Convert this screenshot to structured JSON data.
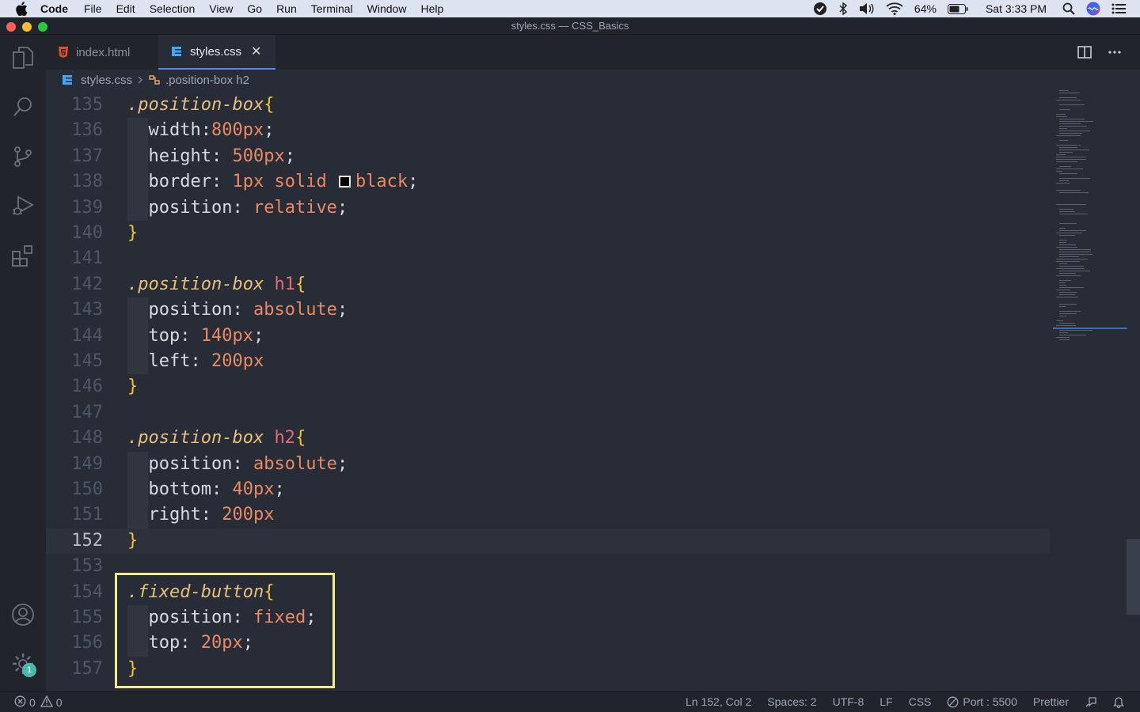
{
  "menubar": {
    "app": "Code",
    "items": [
      "File",
      "Edit",
      "Selection",
      "View",
      "Go",
      "Run",
      "Terminal",
      "Window",
      "Help"
    ],
    "battery": "64%",
    "clock": "Sat 3:33 PM"
  },
  "window": {
    "title": "styles.css — CSS_Basics"
  },
  "tabs": [
    {
      "label": "index.html",
      "icon": "html5-icon",
      "active": false
    },
    {
      "label": "styles.css",
      "icon": "css3-icon",
      "active": true
    }
  ],
  "breadcrumb": {
    "file": "styles.css",
    "symbol": ".position-box h2"
  },
  "activity_badge": "1",
  "code": {
    "current_line": 152,
    "lines": [
      {
        "n": "135",
        "tokens": [
          [
            "sel",
            ".position-box"
          ],
          [
            "brace",
            "{"
          ]
        ]
      },
      {
        "n": "136",
        "tokens": [
          [
            "prop",
            "width"
          ],
          [
            "punct",
            ":"
          ],
          [
            "val",
            "800px"
          ],
          [
            "punct",
            ";"
          ]
        ]
      },
      {
        "n": "137",
        "tokens": [
          [
            "prop",
            "height"
          ],
          [
            "punct",
            ": "
          ],
          [
            "val",
            "500px"
          ],
          [
            "punct",
            ";"
          ]
        ]
      },
      {
        "n": "138",
        "tokens": [
          [
            "prop",
            "border"
          ],
          [
            "punct",
            ": "
          ],
          [
            "val",
            "1px solid "
          ],
          [
            "swatch",
            ""
          ],
          [
            "val",
            "black"
          ],
          [
            "punct",
            ";"
          ]
        ]
      },
      {
        "n": "139",
        "tokens": [
          [
            "prop",
            "position"
          ],
          [
            "punct",
            ": "
          ],
          [
            "val",
            "relative"
          ],
          [
            "punct",
            ";"
          ]
        ]
      },
      {
        "n": "140",
        "tokens": [
          [
            "brace",
            "}"
          ]
        ]
      },
      {
        "n": "141",
        "tokens": []
      },
      {
        "n": "142",
        "tokens": [
          [
            "sel",
            ".position-box "
          ],
          [
            "tag",
            "h1"
          ],
          [
            "brace",
            "{"
          ]
        ]
      },
      {
        "n": "143",
        "tokens": [
          [
            "prop",
            "position"
          ],
          [
            "punct",
            ": "
          ],
          [
            "val",
            "absolute"
          ],
          [
            "punct",
            ";"
          ]
        ]
      },
      {
        "n": "144",
        "tokens": [
          [
            "prop",
            "top"
          ],
          [
            "punct",
            ": "
          ],
          [
            "val",
            "140px"
          ],
          [
            "punct",
            ";"
          ]
        ]
      },
      {
        "n": "145",
        "tokens": [
          [
            "prop",
            "left"
          ],
          [
            "punct",
            ": "
          ],
          [
            "val",
            "200px"
          ]
        ]
      },
      {
        "n": "146",
        "tokens": [
          [
            "brace",
            "}"
          ]
        ]
      },
      {
        "n": "147",
        "tokens": []
      },
      {
        "n": "148",
        "tokens": [
          [
            "sel",
            ".position-box "
          ],
          [
            "tag",
            "h2"
          ],
          [
            "brace",
            "{"
          ]
        ]
      },
      {
        "n": "149",
        "tokens": [
          [
            "prop",
            "position"
          ],
          [
            "punct",
            ": "
          ],
          [
            "val",
            "absolute"
          ],
          [
            "punct",
            ";"
          ]
        ]
      },
      {
        "n": "150",
        "tokens": [
          [
            "prop",
            "bottom"
          ],
          [
            "punct",
            ": "
          ],
          [
            "val",
            "40px"
          ],
          [
            "punct",
            ";"
          ]
        ]
      },
      {
        "n": "151",
        "tokens": [
          [
            "prop",
            "right"
          ],
          [
            "punct",
            ": "
          ],
          [
            "val",
            "200px"
          ]
        ]
      },
      {
        "n": "152",
        "tokens": [
          [
            "brace",
            "}"
          ]
        ]
      },
      {
        "n": "153",
        "tokens": []
      },
      {
        "n": "154",
        "tokens": [
          [
            "sel",
            ".fixed-button"
          ],
          [
            "brace",
            "{"
          ]
        ]
      },
      {
        "n": "155",
        "tokens": [
          [
            "prop",
            "position"
          ],
          [
            "punct",
            ": "
          ],
          [
            "val",
            "fixed"
          ],
          [
            "punct",
            ";"
          ]
        ]
      },
      {
        "n": "156",
        "tokens": [
          [
            "prop",
            "top"
          ],
          [
            "punct",
            ": "
          ],
          [
            "val",
            "20px"
          ],
          [
            "punct",
            ";"
          ]
        ]
      },
      {
        "n": "157",
        "tokens": [
          [
            "brace",
            "}"
          ]
        ]
      }
    ]
  },
  "status": {
    "errors": "0",
    "warnings": "0",
    "position": "Ln 152, Col 2",
    "spaces": "Spaces: 2",
    "encoding": "UTF-8",
    "eol": "LF",
    "language": "CSS",
    "port": "Port : 5500",
    "formatter": "Prettier"
  },
  "colors": {
    "selector": "#e5c07b",
    "tag": "#e06c75",
    "brace": "#f5c22d",
    "value": "#e88a63",
    "highlight_box": "#f4ee8a",
    "accent": "#568af2"
  }
}
